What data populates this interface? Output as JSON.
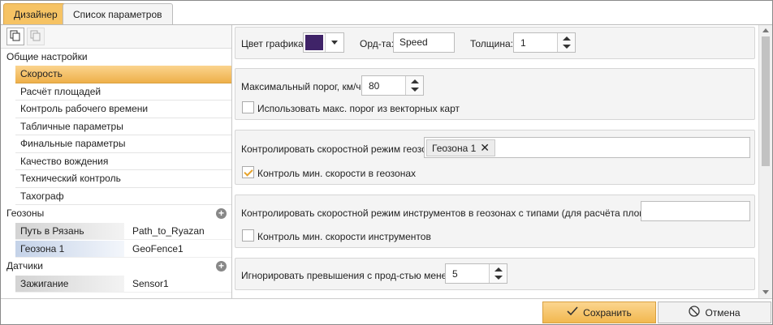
{
  "tabs": [
    {
      "label": "Дизайнер"
    },
    {
      "label": "Список параметров"
    }
  ],
  "left": {
    "general_title": "Общие настройки",
    "general_items": [
      "Скорость",
      "Расчёт площадей",
      "Контроль рабочего времени",
      "Табличные параметры",
      "Финальные параметры",
      "Качество вождения",
      "Технический контроль",
      "Тахограф"
    ],
    "geozones_title": "Геозоны",
    "geozones": [
      {
        "key": "Путь в Рязань",
        "value": "Path_to_Ryazan"
      },
      {
        "key": "Геозона 1",
        "value": "GeoFence1"
      }
    ],
    "sensors_title": "Датчики",
    "sensors": [
      {
        "key": "Зажигание",
        "value": "Sensor1"
      }
    ]
  },
  "p1": {
    "color_label": "Цвет графика:",
    "color_value": "#3f2368",
    "ord_label": "Орд-та:",
    "ord_value": "Speed",
    "thickness_label": "Толщина:",
    "thickness_value": "1"
  },
  "p2": {
    "max_label": "Максимальный порог, км/ч:",
    "max_value": "80",
    "use_vector_label": "Использовать макс. порог из векторных карт"
  },
  "p3": {
    "control_label": "Контролировать скоростной режим геозон:",
    "chip": "Геозона 1",
    "min_label": "Контроль мин. скорости в геозонах"
  },
  "p4": {
    "control_label": "Контролировать скоростной режим инструментов в геозонах с типами (для расчёта площадей):",
    "min_label": "Контроль мин. скорости инструментов"
  },
  "p5": {
    "ignore_label": "Игнорировать превышения с прод-стью менее, с",
    "ignore_value": "5"
  },
  "buttons": {
    "save": "Сохранить",
    "cancel": "Отмена"
  },
  "colors": {
    "accent": "#f6c364",
    "selected_item": "#eeb04a",
    "check": "#e6a22a"
  }
}
